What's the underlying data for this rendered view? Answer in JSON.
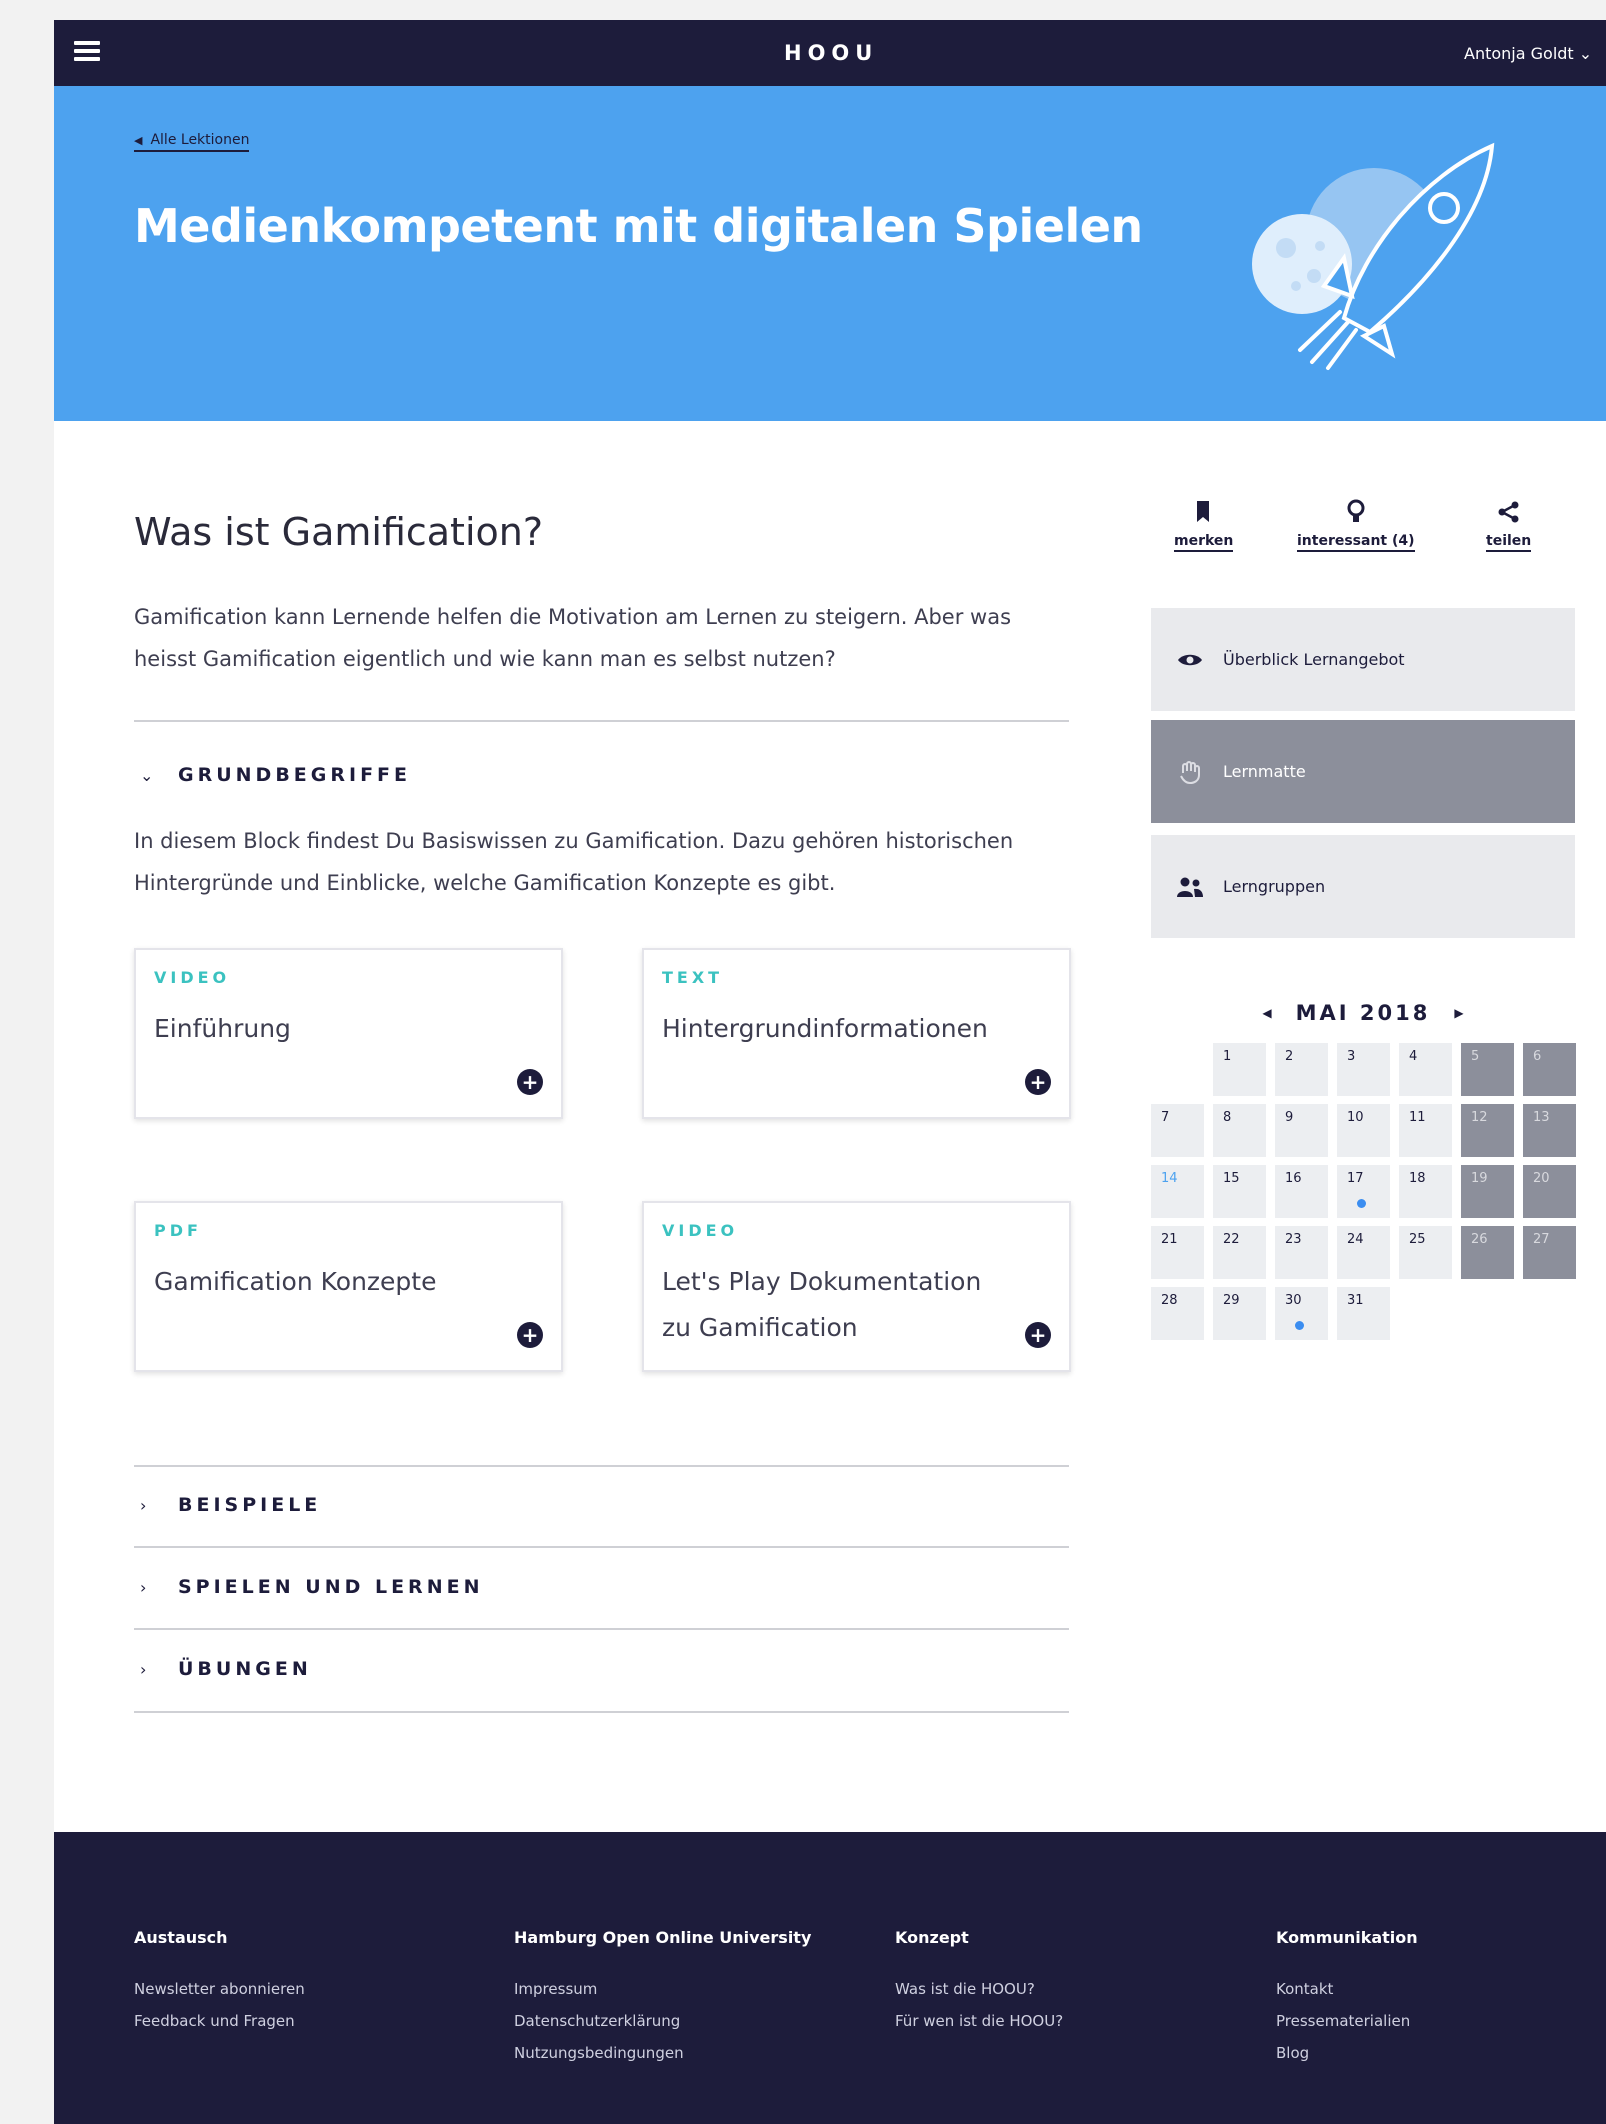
{
  "nav": {
    "brand": "HOOU",
    "user": "Antonja Goldt"
  },
  "hero": {
    "back_link": "Alle Lektionen",
    "title": "Medienkompetent mit digitalen Spielen"
  },
  "main": {
    "heading": "Was ist Gamification?",
    "intro": "Gamification kann Lernende helfen die Motivation am Lernen zu steigern. Aber was heisst Gamification eigentlich und wie kann man es selbst nutzen?",
    "open_section": {
      "label": "GRUNDBEGRIFFE",
      "text": "In diesem Block findest Du Basiswissen zu Gamification. Dazu gehören historischen Hintergründe und Einblicke, welche Gamification Konzepte es gibt.",
      "cards": [
        {
          "type": "VIDEO",
          "title": "Einführung"
        },
        {
          "type": "TEXT",
          "title": "Hintergrundinformationen"
        },
        {
          "type": "PDF",
          "title": "Gamification Konzepte"
        },
        {
          "type": "VIDEO",
          "title": "Let's Play Dokumentation zu Gamification"
        }
      ]
    },
    "collapsed_sections": [
      "BEISPIELE",
      "SPIELEN UND LERNEN",
      "ÜBUNGEN"
    ]
  },
  "sidebar": {
    "actions": [
      "merken",
      "interessant (4)",
      "teilen"
    ],
    "nav": [
      "Überblick Lernangebot",
      "Lernmatte",
      "Lerngruppen"
    ],
    "calendar": {
      "title": "MAI 2018",
      "days": [
        [
          "",
          "1",
          "2",
          "3",
          "4",
          "5",
          "6"
        ],
        [
          "7",
          "8",
          "9",
          "10",
          "11",
          "12",
          "13"
        ],
        [
          "14",
          "15",
          "16",
          "17",
          "18",
          "19",
          "20"
        ],
        [
          "21",
          "22",
          "23",
          "24",
          "25",
          "26",
          "27"
        ],
        [
          "28",
          "29",
          "30",
          "31",
          "",
          "",
          ""
        ]
      ],
      "today": "14",
      "event_days": [
        "17",
        "30"
      ]
    }
  },
  "footer": {
    "columns": [
      {
        "title": "Austausch",
        "links": [
          "Newsletter abonnieren",
          "Feedback und Fragen"
        ]
      },
      {
        "title": "Hamburg Open Online University",
        "links": [
          "Impressum",
          "Datenschutzerklärung",
          "Nutzungsbedingungen"
        ]
      },
      {
        "title": "Konzept",
        "links": [
          "Was ist die HOOU?",
          "Für wen ist die HOOU?"
        ]
      },
      {
        "title": "Kommunikation",
        "links": [
          "Kontakt",
          "Pressematerialien",
          "Blog"
        ]
      }
    ]
  },
  "colors": {
    "navy": "#1d1c3b",
    "hero_blue": "#4da2ef",
    "card_type": "#3bc2c0",
    "active_nav": "#8c8f9b"
  }
}
